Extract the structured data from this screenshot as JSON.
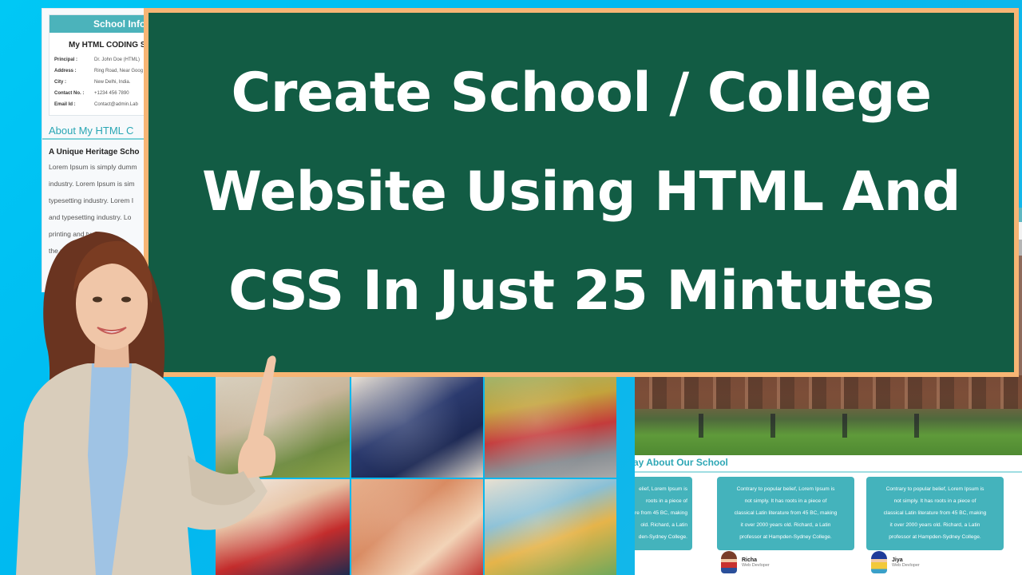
{
  "thumbnail": {
    "headline_lines": [
      "Create School / College",
      "Website Using HTML And",
      "CSS In Just 25 Mintutes"
    ],
    "colors": {
      "background": "#00c2f2",
      "board": "#125c44",
      "board_frame": "#f7b574",
      "accent_teal": "#44b3bc"
    }
  },
  "info_panel": {
    "header": "School Info",
    "school_name": "My HTML CODING S",
    "rows": [
      {
        "label": "Principal :",
        "value": "Dr. John Doe (HTML)"
      },
      {
        "label": "Address :",
        "value": "Ring Road, Near Goog"
      },
      {
        "label": "City :",
        "value": "New Delhi, India."
      },
      {
        "label": "Contact No. :",
        "value": "+1234 456 7890"
      },
      {
        "label": "Email Id :",
        "value": "Contact@admin.Lab"
      }
    ],
    "about_title": "About My HTML C",
    "about_subtitle": "A Unique Heritage Scho",
    "about_lines": [
      "Lorem Ipsum is simply dumm",
      "industry. Lorem Ipsum is sim",
      "typesetting industry. Lorem I",
      "and typesetting industry. Lo",
      "printing and ty",
      "the printin"
    ]
  },
  "testimonials": {
    "title": "ay About Our School",
    "cards": [
      {
        "lines": [
          "elief, Lorem Ipsum is",
          "roots in a piece of",
          "re from 45 BC, making",
          "old. Richard, a Latin",
          "den-Sydney College."
        ]
      },
      {
        "lines": [
          "Contrary to popular belief, Lorem Ipsum is",
          "not simply. It has roots in a piece of",
          "classical Latin literature from 45 BC, making",
          "it over 2000 years old. Richard, a Latin",
          "professor at Hampden-Sydney College."
        ]
      },
      {
        "lines": [
          "Contrary to popular belief, Lorem Ipsum is",
          "not simply. It has roots in a piece of",
          "classical Latin literature from 45 BC, making",
          "it over 2000 years old. Richard, a Latin",
          "professor at Hampden-Sydney College."
        ]
      }
    ],
    "authors": [
      {
        "name": "Richa",
        "role": "Web Devloper"
      },
      {
        "name": "Jiya",
        "role": "Web Devloper"
      }
    ]
  },
  "collage": {
    "photos": [
      "children-playing-blocks",
      "students-in-class",
      "kids-with-backpacks",
      "boys-reading",
      "child-drawing",
      "children-classroom"
    ]
  }
}
